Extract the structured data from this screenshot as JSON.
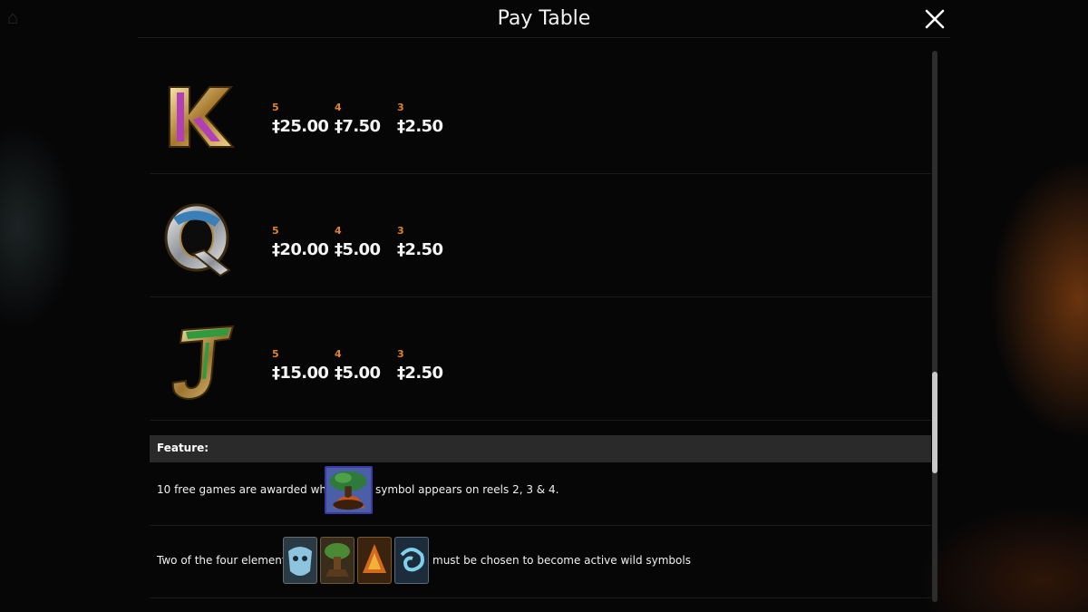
{
  "window": {
    "title": "Pay Table",
    "close_icon": "close-icon"
  },
  "paytable": [
    {
      "symbol": "K",
      "symbol_icon": "letter-k-icon",
      "symbol_color": "#b23fb8",
      "payouts": [
        {
          "count": "5",
          "amount": "‡25.00"
        },
        {
          "count": "4",
          "amount": "‡7.50"
        },
        {
          "count": "3",
          "amount": "‡2.50"
        }
      ]
    },
    {
      "symbol": "Q",
      "symbol_icon": "letter-q-icon",
      "symbol_color": "#3b7fb8",
      "payouts": [
        {
          "count": "5",
          "amount": "‡20.00"
        },
        {
          "count": "4",
          "amount": "‡5.00"
        },
        {
          "count": "3",
          "amount": "‡2.50"
        }
      ]
    },
    {
      "symbol": "J",
      "symbol_icon": "letter-j-icon",
      "symbol_color": "#2f9a3e",
      "payouts": [
        {
          "count": "5",
          "amount": "‡15.00"
        },
        {
          "count": "4",
          "amount": "‡5.00"
        },
        {
          "count": "3",
          "amount": "‡2.50"
        }
      ]
    }
  ],
  "feature": {
    "heading": "Feature:",
    "free_games_before": "10 free games are awarded when",
    "free_games_after": "symbol appears on reels 2, 3 & 4.",
    "scatter_icon": "tree-scatter-icon",
    "wild_before": "Two of the four elements",
    "wild_after": "must be chosen to become active wild symbols",
    "wild_icons": [
      "water-element-icon",
      "earth-element-icon",
      "fire-element-icon",
      "air-element-icon"
    ]
  },
  "colors": {
    "count": "#e0822a",
    "amount": "#f5f5f5",
    "feature_bar": "#2a2a2a",
    "scroll_thumb": "#c9c9c9"
  },
  "scrollbar": {
    "position_fraction": 0.71
  }
}
